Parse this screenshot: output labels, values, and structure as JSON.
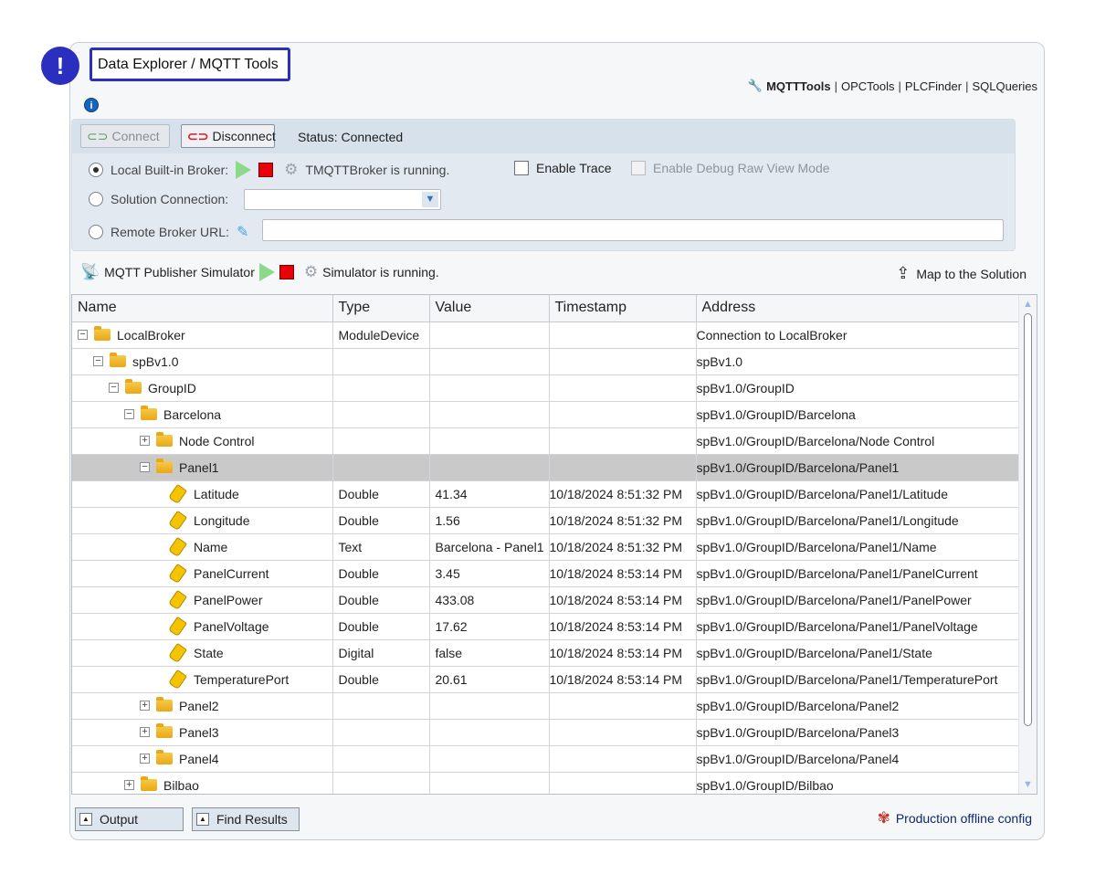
{
  "title": "Data Explorer / MQTT Tools",
  "callout_mark": "!",
  "top_links": {
    "active": "MQTTTools",
    "items": [
      "OPCTools",
      "PLCFinder",
      "SQLQueries"
    ],
    "separator": "|"
  },
  "info_icon": "i",
  "toolbar": {
    "connect_label": "Connect",
    "disconnect_label": "Disconnect",
    "status": "Status: Connected"
  },
  "broker": {
    "local_label": "Local Built-in Broker:",
    "local_status": "TMQTTBroker is running.",
    "enable_trace": "Enable Trace",
    "enable_debug": "Enable Debug Raw View Mode",
    "solution_label": "Solution Connection:",
    "solution_value": "",
    "remote_label": "Remote Broker URL:",
    "remote_value": ""
  },
  "simulator": {
    "label": "MQTT Publisher Simulator",
    "status": "Simulator is running.",
    "map_label": "Map to the Solution"
  },
  "grid": {
    "columns": [
      "Name",
      "Type",
      "Value",
      "Timestamp",
      "Address"
    ],
    "rows": [
      {
        "name": "LocalBroker",
        "type": "ModuleDevice",
        "value": "",
        "timestamp": "",
        "address": "Connection to LocalBroker"
      },
      {
        "name": "spBv1.0",
        "type": "",
        "value": "",
        "timestamp": "",
        "address": "spBv1.0"
      },
      {
        "name": "GroupID",
        "type": "",
        "value": "",
        "timestamp": "",
        "address": "spBv1.0/GroupID"
      },
      {
        "name": "Barcelona",
        "type": "",
        "value": "",
        "timestamp": "",
        "address": "spBv1.0/GroupID/Barcelona"
      },
      {
        "name": "Node Control",
        "type": "",
        "value": "",
        "timestamp": "",
        "address": "spBv1.0/GroupID/Barcelona/Node Control"
      },
      {
        "name": "Panel1",
        "type": "",
        "value": "",
        "timestamp": "",
        "address": "spBv1.0/GroupID/Barcelona/Panel1"
      },
      {
        "name": "Latitude",
        "type": "Double",
        "value": "41.34",
        "timestamp": "10/18/2024 8:51:32 PM",
        "address": "spBv1.0/GroupID/Barcelona/Panel1/Latitude"
      },
      {
        "name": "Longitude",
        "type": "Double",
        "value": "1.56",
        "timestamp": "10/18/2024 8:51:32 PM",
        "address": "spBv1.0/GroupID/Barcelona/Panel1/Longitude"
      },
      {
        "name": "Name",
        "type": "Text",
        "value": "Barcelona - Panel1",
        "timestamp": "10/18/2024 8:51:32 PM",
        "address": "spBv1.0/GroupID/Barcelona/Panel1/Name"
      },
      {
        "name": "PanelCurrent",
        "type": "Double",
        "value": "3.45",
        "timestamp": "10/18/2024 8:53:14 PM",
        "address": "spBv1.0/GroupID/Barcelona/Panel1/PanelCurrent"
      },
      {
        "name": "PanelPower",
        "type": "Double",
        "value": "433.08",
        "timestamp": "10/18/2024 8:53:14 PM",
        "address": "spBv1.0/GroupID/Barcelona/Panel1/PanelPower"
      },
      {
        "name": "PanelVoltage",
        "type": "Double",
        "value": "17.62",
        "timestamp": "10/18/2024 8:53:14 PM",
        "address": "spBv1.0/GroupID/Barcelona/Panel1/PanelVoltage"
      },
      {
        "name": "State",
        "type": "Digital",
        "value": "false",
        "timestamp": "10/18/2024 8:53:14 PM",
        "address": "spBv1.0/GroupID/Barcelona/Panel1/State"
      },
      {
        "name": "TemperaturePort",
        "type": "Double",
        "value": "20.61",
        "timestamp": "10/18/2024 8:53:14 PM",
        "address": "spBv1.0/GroupID/Barcelona/Panel1/TemperaturePort"
      },
      {
        "name": "Panel2",
        "type": "",
        "value": "",
        "timestamp": "",
        "address": "spBv1.0/GroupID/Barcelona/Panel2"
      },
      {
        "name": "Panel3",
        "type": "",
        "value": "",
        "timestamp": "",
        "address": "spBv1.0/GroupID/Barcelona/Panel3"
      },
      {
        "name": "Panel4",
        "type": "",
        "value": "",
        "timestamp": "",
        "address": "spBv1.0/GroupID/Barcelona/Panel4"
      },
      {
        "name": "Bilbao",
        "type": "",
        "value": "",
        "timestamp": "",
        "address": "spBv1.0/GroupID/Bilbao"
      }
    ]
  },
  "bottom": {
    "output_label": "Output",
    "find_label": "Find Results",
    "production_label": "Production offline config"
  },
  "colors": {
    "accent": "#2b2fbf",
    "selected_row": "#c9c9c9",
    "stop_red": "#e8000b",
    "play_green": "#8cd98c"
  }
}
